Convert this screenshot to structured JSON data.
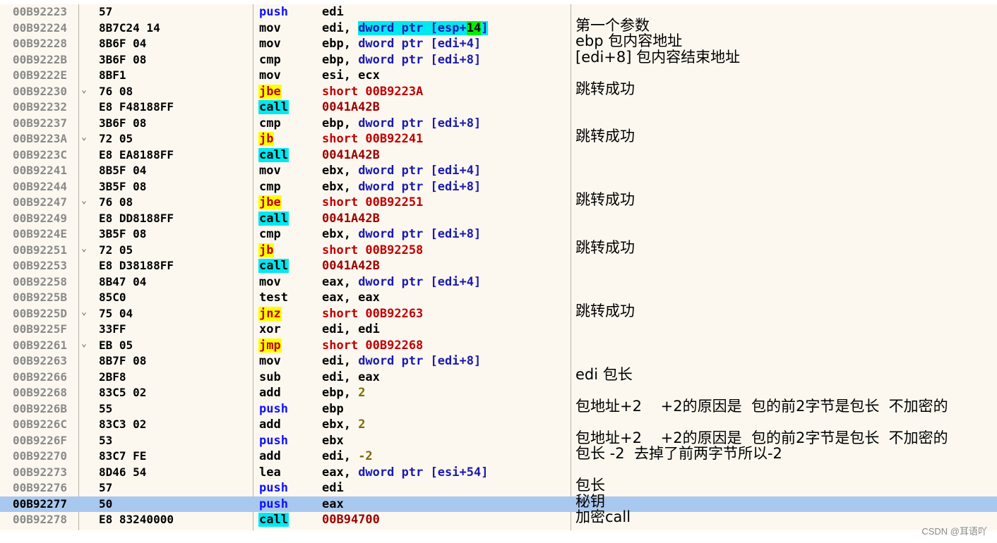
{
  "colors": {
    "background": "#fcf8f0",
    "selected_row": "#a9c8ef",
    "call_highlight": "#00e8f0",
    "jump_highlight": "#ffff00",
    "imm_highlight": "#00f000",
    "push_color": "#1010ff",
    "jump_text": "#c00000",
    "ptr_color": "#1a1ab0",
    "num_color": "#7a6a00",
    "target_color": "#a00000"
  },
  "watermark": "CSDN @耳语吖",
  "rows": [
    {
      "addr": "00B92223",
      "hex": "57",
      "mn": "push",
      "ops": [
        {
          "t": "edi"
        }
      ]
    },
    {
      "addr": "00B92224",
      "hex": "8B7C24 14",
      "mn": "mov",
      "ops": [
        {
          "t": "edi, "
        },
        {
          "t": "dword ptr [esp+",
          "hl": "ptr"
        },
        {
          "t": "14",
          "hl": "imm"
        },
        {
          "t": "]",
          "hl": "ptr"
        }
      ],
      "cmt": "第一个参数"
    },
    {
      "addr": "00B92228",
      "hex": "8B6F 04",
      "mn": "mov",
      "ops": [
        {
          "t": "ebp, "
        },
        {
          "t": "dword ptr",
          "s": "ptr"
        },
        {
          "t": " [edi+4]",
          "s": "ptr"
        }
      ],
      "cmt": "ebp 包内容地址"
    },
    {
      "addr": "00B9222B",
      "hex": "3B6F 08",
      "mn": "cmp",
      "ops": [
        {
          "t": "ebp, "
        },
        {
          "t": "dword ptr",
          "s": "ptr"
        },
        {
          "t": " [edi+8]",
          "s": "ptr"
        }
      ],
      "cmt": "[edi+8] 包内容结束地址"
    },
    {
      "addr": "00B9222E",
      "hex": "8BF1",
      "mn": "mov",
      "ops": [
        {
          "t": "esi, ecx"
        }
      ]
    },
    {
      "addr": "00B92230",
      "jm": "⌄",
      "hex": "76 08",
      "mn": "jbe",
      "ops": [
        {
          "t": "short 00B9223A",
          "s": "jmp"
        }
      ],
      "cmt": "跳转成功"
    },
    {
      "addr": "00B92232",
      "hex": "E8 F48188FF",
      "mn": "call",
      "ops": [
        {
          "t": "0041A42B",
          "s": "tgt"
        }
      ]
    },
    {
      "addr": "00B92237",
      "hex": "3B6F 08",
      "mn": "cmp",
      "ops": [
        {
          "t": "ebp, "
        },
        {
          "t": "dword ptr",
          "s": "ptr"
        },
        {
          "t": " [edi+8]",
          "s": "ptr"
        }
      ]
    },
    {
      "addr": "00B9223A",
      "jm": "⌄",
      "hex": "72 05",
      "mn": "jb",
      "ops": [
        {
          "t": "short 00B92241",
          "s": "jmp"
        }
      ],
      "cmt": "跳转成功"
    },
    {
      "addr": "00B9223C",
      "hex": "E8 EA8188FF",
      "mn": "call",
      "ops": [
        {
          "t": "0041A42B",
          "s": "tgt"
        }
      ]
    },
    {
      "addr": "00B92241",
      "hex": "8B5F 04",
      "mn": "mov",
      "ops": [
        {
          "t": "ebx, "
        },
        {
          "t": "dword ptr",
          "s": "ptr"
        },
        {
          "t": " [edi+4]",
          "s": "ptr"
        }
      ]
    },
    {
      "addr": "00B92244",
      "hex": "3B5F 08",
      "mn": "cmp",
      "ops": [
        {
          "t": "ebx, "
        },
        {
          "t": "dword ptr",
          "s": "ptr"
        },
        {
          "t": " [edi+8]",
          "s": "ptr"
        }
      ]
    },
    {
      "addr": "00B92247",
      "jm": "⌄",
      "hex": "76 08",
      "mn": "jbe",
      "ops": [
        {
          "t": "short 00B92251",
          "s": "jmp"
        }
      ],
      "cmt": "跳转成功"
    },
    {
      "addr": "00B92249",
      "hex": "E8 DD8188FF",
      "mn": "call",
      "ops": [
        {
          "t": "0041A42B",
          "s": "tgt"
        }
      ]
    },
    {
      "addr": "00B9224E",
      "hex": "3B5F 08",
      "mn": "cmp",
      "ops": [
        {
          "t": "ebx, "
        },
        {
          "t": "dword ptr",
          "s": "ptr"
        },
        {
          "t": " [edi+8]",
          "s": "ptr"
        }
      ]
    },
    {
      "addr": "00B92251",
      "jm": "⌄",
      "hex": "72 05",
      "mn": "jb",
      "ops": [
        {
          "t": "short 00B92258",
          "s": "jmp"
        }
      ],
      "cmt": "跳转成功"
    },
    {
      "addr": "00B92253",
      "hex": "E8 D38188FF",
      "mn": "call",
      "ops": [
        {
          "t": "0041A42B",
          "s": "tgt"
        }
      ]
    },
    {
      "addr": "00B92258",
      "hex": "8B47 04",
      "mn": "mov",
      "ops": [
        {
          "t": "eax, "
        },
        {
          "t": "dword ptr",
          "s": "ptr"
        },
        {
          "t": " [edi+4]",
          "s": "ptr"
        }
      ]
    },
    {
      "addr": "00B9225B",
      "hex": "85C0",
      "mn": "test",
      "ops": [
        {
          "t": "eax, eax"
        }
      ]
    },
    {
      "addr": "00B9225D",
      "jm": "⌄",
      "hex": "75 04",
      "mn": "jnz",
      "ops": [
        {
          "t": "short 00B92263",
          "s": "jmp"
        }
      ],
      "cmt": "跳转成功"
    },
    {
      "addr": "00B9225F",
      "hex": "33FF",
      "mn": "xor",
      "ops": [
        {
          "t": "edi, edi"
        }
      ]
    },
    {
      "addr": "00B92261",
      "jm": "⌄",
      "hex": "EB 05",
      "mn": "jmp",
      "ops": [
        {
          "t": "short 00B92268",
          "s": "jmp"
        }
      ]
    },
    {
      "addr": "00B92263",
      "hex": "8B7F 08",
      "mn": "mov",
      "ops": [
        {
          "t": "edi, "
        },
        {
          "t": "dword ptr",
          "s": "ptr"
        },
        {
          "t": " [edi+8]",
          "s": "ptr"
        }
      ]
    },
    {
      "addr": "00B92266",
      "hex": "2BF8",
      "mn": "sub",
      "ops": [
        {
          "t": "edi, eax"
        }
      ],
      "cmt": "edi 包长"
    },
    {
      "addr": "00B92268",
      "hex": "83C5 02",
      "mn": "add",
      "ops": [
        {
          "t": "ebp, "
        },
        {
          "t": "2",
          "s": "num"
        }
      ]
    },
    {
      "addr": "00B9226B",
      "hex": "55",
      "mn": "push",
      "ops": [
        {
          "t": "ebp"
        }
      ],
      "cmt": "包地址+2    +2的原因是  包的前2字节是包长  不加密的"
    },
    {
      "addr": "00B9226C",
      "hex": "83C3 02",
      "mn": "add",
      "ops": [
        {
          "t": "ebx, "
        },
        {
          "t": "2",
          "s": "num"
        }
      ]
    },
    {
      "addr": "00B9226F",
      "hex": "53",
      "mn": "push",
      "ops": [
        {
          "t": "ebx"
        }
      ],
      "cmt": "包地址+2    +2的原因是  包的前2字节是包长  不加密的"
    },
    {
      "addr": "00B92270",
      "hex": "83C7 FE",
      "mn": "add",
      "ops": [
        {
          "t": "edi, "
        },
        {
          "t": "-2",
          "s": "num"
        }
      ],
      "cmt": "包长 -2  去掉了前两字节所以-2"
    },
    {
      "addr": "00B92273",
      "hex": "8D46 54",
      "mn": "lea",
      "ops": [
        {
          "t": "eax, "
        },
        {
          "t": "dword ptr",
          "s": "ptr"
        },
        {
          "t": " [esi+54]",
          "s": "ptr"
        }
      ]
    },
    {
      "addr": "00B92276",
      "hex": "57",
      "mn": "push",
      "ops": [
        {
          "t": "edi"
        }
      ],
      "cmt": "包长"
    },
    {
      "addr": "00B92277",
      "hex": "50",
      "mn": "push",
      "ops": [
        {
          "t": "eax"
        }
      ],
      "cmt": "秘钥",
      "sel": true
    },
    {
      "addr": "00B92278",
      "hex": "E8 83240000",
      "mn": "call",
      "ops": [
        {
          "t": "00B94700",
          "s": "tgt"
        }
      ],
      "cmt": "加密call"
    }
  ]
}
